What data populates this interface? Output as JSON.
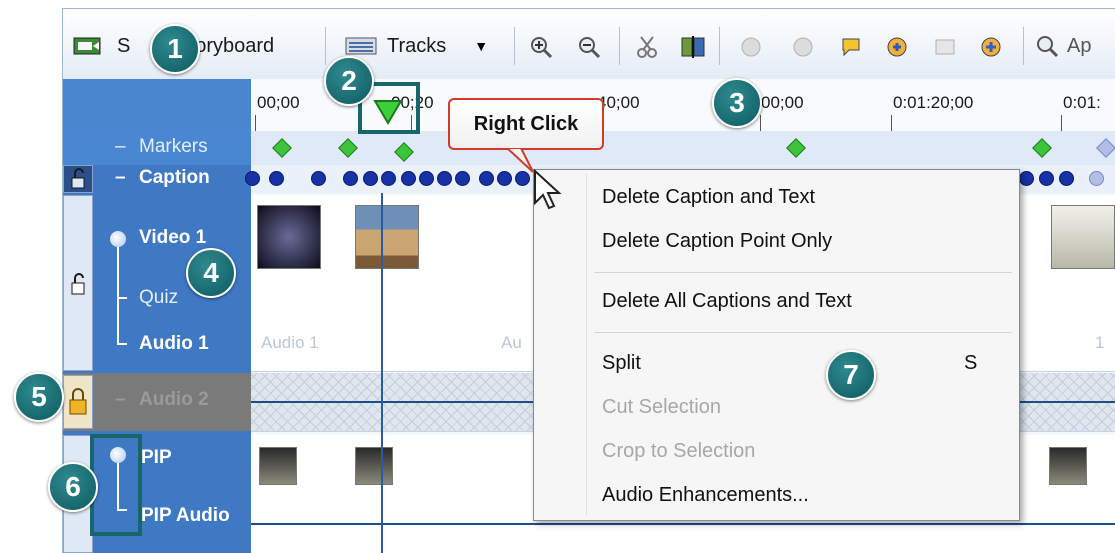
{
  "toolbar": {
    "storyboard_prefix": "S",
    "storyboard_label": "Storyboard",
    "tracks_label": "Tracks",
    "apply_label_partial": "Ap"
  },
  "ruler": {
    "ticks": [
      "00;00",
      "00;20",
      "40;00",
      "00;00",
      "0:01:20;00",
      "0:01:"
    ]
  },
  "tracks": {
    "markers": "Markers",
    "caption": "Caption",
    "video1": "Video 1",
    "quiz": "Quiz",
    "audio1": "Audio 1",
    "audio2": "Audio 2",
    "pip": "PIP",
    "pip_audio": "PIP Audio",
    "audio1_clip_a": "Audio 1",
    "audio1_clip_b": "Au",
    "audio1_clip_c": "1",
    "collapse_symbol": "–"
  },
  "tooltip": {
    "text": "Right Click"
  },
  "context_menu": {
    "items": [
      {
        "label": "Delete Caption and Text",
        "enabled": true
      },
      {
        "label": "Delete Caption Point Only",
        "enabled": true
      },
      {
        "label": "Delete All Captions and Text",
        "enabled": true
      },
      {
        "label": "Split",
        "shortcut": "S",
        "enabled": true
      },
      {
        "label": "Cut Selection",
        "enabled": false
      },
      {
        "label": "Crop to Selection",
        "enabled": false
      },
      {
        "label": "Audio Enhancements...",
        "enabled": true
      }
    ]
  },
  "callouts": [
    "1",
    "2",
    "3",
    "4",
    "5",
    "6",
    "7"
  ],
  "colors": {
    "track_header": "#3f79c4",
    "callout": "#17666a",
    "tooltip_border": "#d23a2a",
    "caption_dot": "#1632a6",
    "marker": "#3cc43a"
  }
}
